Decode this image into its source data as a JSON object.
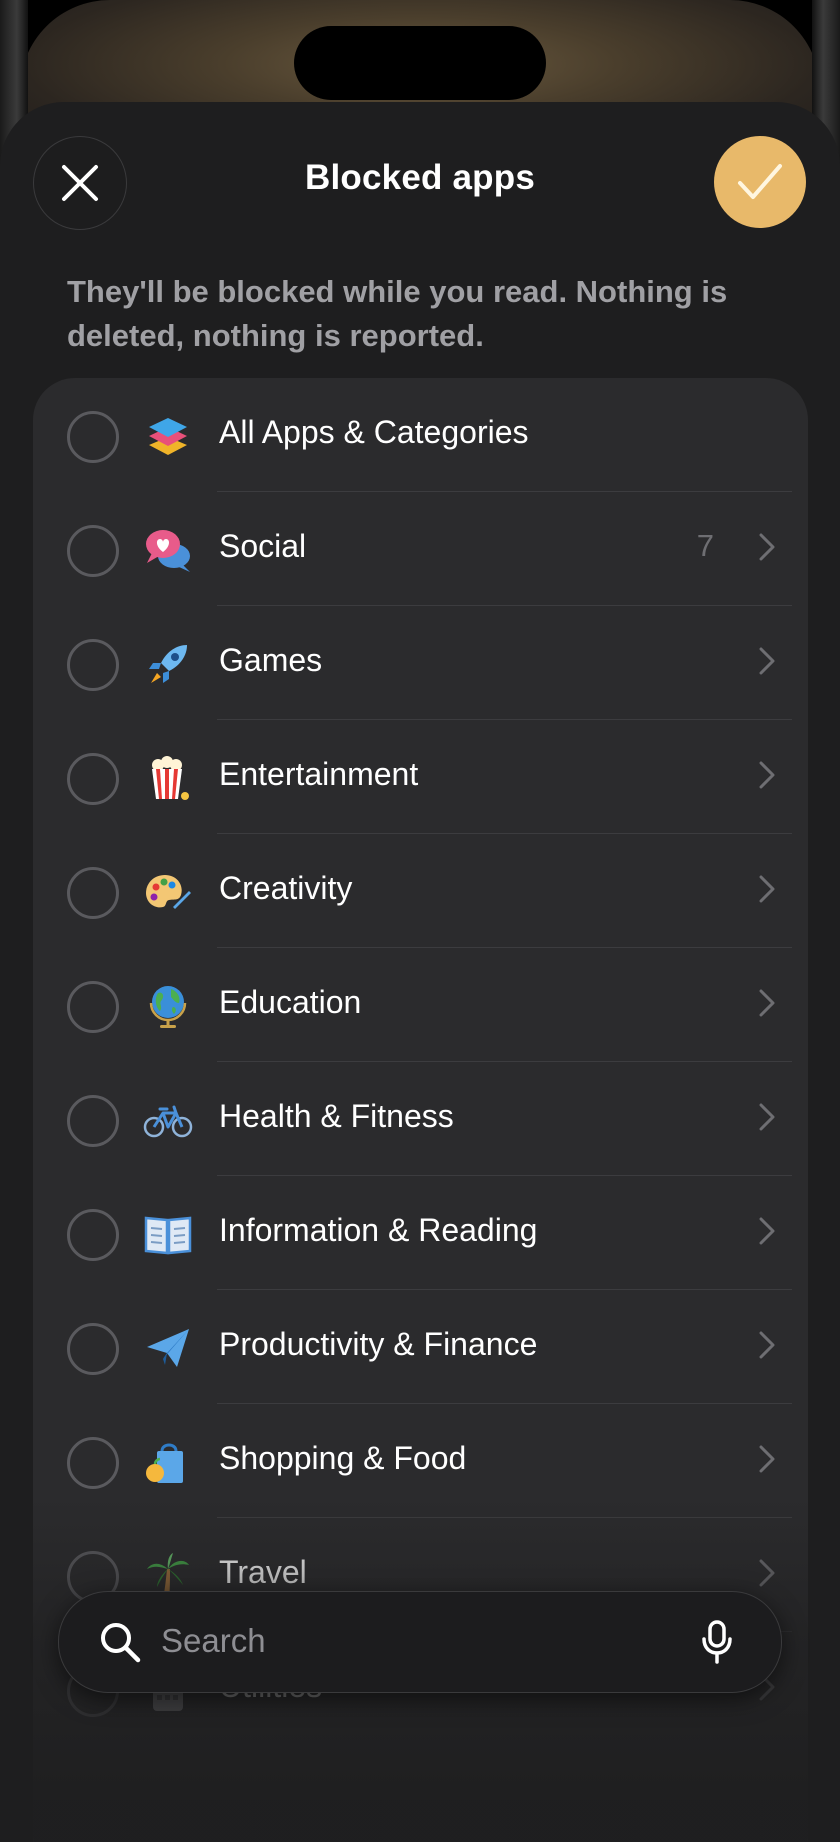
{
  "header": {
    "title": "Blocked apps"
  },
  "subtitle": "They'll be blocked while you read. Nothing is deleted, nothing is reported.",
  "categories": [
    {
      "label": "All Apps & Categories",
      "count": "",
      "icon": "stack-icon"
    },
    {
      "label": "Social",
      "count": "7",
      "icon": "speech-bubble-heart-icon"
    },
    {
      "label": "Games",
      "count": "",
      "icon": "rocket-icon"
    },
    {
      "label": "Entertainment",
      "count": "",
      "icon": "popcorn-icon"
    },
    {
      "label": "Creativity",
      "count": "",
      "icon": "palette-icon"
    },
    {
      "label": "Education",
      "count": "",
      "icon": "globe-icon"
    },
    {
      "label": "Health & Fitness",
      "count": "",
      "icon": "bicycle-icon"
    },
    {
      "label": "Information & Reading",
      "count": "",
      "icon": "open-book-icon"
    },
    {
      "label": "Productivity & Finance",
      "count": "",
      "icon": "paper-plane-icon"
    },
    {
      "label": "Shopping & Food",
      "count": "",
      "icon": "shopping-bag-icon"
    },
    {
      "label": "Travel",
      "count": "",
      "icon": "palm-tree-icon"
    },
    {
      "label": "Utilities",
      "count": "",
      "icon": "calculator-icon"
    }
  ],
  "search": {
    "placeholder": "Search"
  },
  "colors": {
    "accent": "#e8b96a",
    "sheet": "#1e1e1f",
    "list": "#2b2b2d"
  }
}
